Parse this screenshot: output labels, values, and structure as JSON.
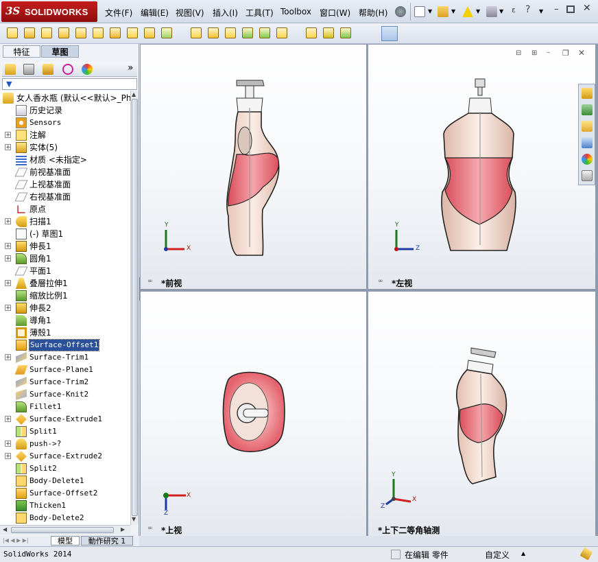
{
  "app": {
    "logo_ds": "3S",
    "logo_name": "SOLIDWORKS"
  },
  "menu": [
    "文件(F)",
    "编辑(E)",
    "视图(V)",
    "插入(I)",
    "工具(T)",
    "Toolbox",
    "窗口(W)",
    "帮助(H)"
  ],
  "panel": {
    "tabs": [
      "特征",
      "草图"
    ],
    "root": "女人香水瓶  (默认<<默认>_Ph",
    "expand_more": "»"
  },
  "tree": [
    {
      "label": "历史记录",
      "icon": "history-icon",
      "exp": ""
    },
    {
      "label": "Sensors",
      "icon": "sensor-icon",
      "exp": ""
    },
    {
      "label": "注解",
      "icon": "annotation-icon",
      "exp": "+"
    },
    {
      "label": "实体(5)",
      "icon": "solid-bodies-icon",
      "exp": "+"
    },
    {
      "label": "材质 <未指定>",
      "icon": "material-icon",
      "exp": ""
    },
    {
      "label": "前视基准面",
      "icon": "plane-icon",
      "exp": ""
    },
    {
      "label": "上视基准面",
      "icon": "plane-icon",
      "exp": ""
    },
    {
      "label": "右视基准面",
      "icon": "plane-icon",
      "exp": ""
    },
    {
      "label": "原点",
      "icon": "origin-icon",
      "exp": ""
    },
    {
      "label": "扫描1",
      "icon": "sweep-icon",
      "exp": "+"
    },
    {
      "label": "(-) 草图1",
      "icon": "sketch-icon",
      "exp": ""
    },
    {
      "label": "伸長1",
      "icon": "extrude-icon",
      "exp": "+"
    },
    {
      "label": "圆角1",
      "icon": "fillet-icon",
      "exp": "+"
    },
    {
      "label": "平面1",
      "icon": "plane-icon",
      "exp": ""
    },
    {
      "label": "叠層拉伸1",
      "icon": "loft-icon",
      "exp": "+"
    },
    {
      "label": "缩放比例1",
      "icon": "scale-icon",
      "exp": ""
    },
    {
      "label": "伸長2",
      "icon": "extrude-icon",
      "exp": "+"
    },
    {
      "label": "導角1",
      "icon": "chamfer-icon",
      "exp": ""
    },
    {
      "label": "薄殼1",
      "icon": "shell-icon",
      "exp": ""
    },
    {
      "label": "Surface-Offset1",
      "icon": "surface-offset-icon",
      "exp": "",
      "selected": true
    },
    {
      "label": "Surface-Trim1",
      "icon": "surface-trim-icon",
      "exp": "+"
    },
    {
      "label": "Surface-Plane1",
      "icon": "surface-plane-icon",
      "exp": ""
    },
    {
      "label": "Surface-Trim2",
      "icon": "surface-trim-icon",
      "exp": ""
    },
    {
      "label": "Surface-Knit2",
      "icon": "surface-knit-icon",
      "exp": ""
    },
    {
      "label": "Fillet1",
      "icon": "fillet-icon",
      "exp": ""
    },
    {
      "label": "Surface-Extrude1",
      "icon": "surface-extrude-icon",
      "exp": "+"
    },
    {
      "label": "Split1",
      "icon": "split-icon",
      "exp": ""
    },
    {
      "label": "push->?",
      "icon": "push-icon",
      "exp": "+"
    },
    {
      "label": "Surface-Extrude2",
      "icon": "surface-extrude-icon",
      "exp": "+"
    },
    {
      "label": "Split2",
      "icon": "split-icon",
      "exp": ""
    },
    {
      "label": "Body-Delete1",
      "icon": "body-delete-icon",
      "exp": ""
    },
    {
      "label": "Surface-Offset2",
      "icon": "surface-offset-icon",
      "exp": ""
    },
    {
      "label": "Thicken1",
      "icon": "thicken-icon",
      "exp": ""
    },
    {
      "label": "Body-Delete2",
      "icon": "body-delete-icon",
      "exp": ""
    }
  ],
  "viewports": {
    "front": "*前视",
    "left": "*左视",
    "top": "*上视",
    "iso": "*上下二等角轴测"
  },
  "axes": {
    "x": "X",
    "y": "Y",
    "z": "Z"
  },
  "bottom_tabs": [
    "模型",
    "動作研究 1"
  ],
  "status": {
    "app": "SolidWorks 2014",
    "mode": "在编辑 零件",
    "units": "自定义",
    "arrow": "▲"
  },
  "colors": {
    "brand": "#b01818",
    "bottle_pink": "#e8707a",
    "bottle_skin": "#f2dcd0",
    "selection": "#2a4f9b"
  }
}
